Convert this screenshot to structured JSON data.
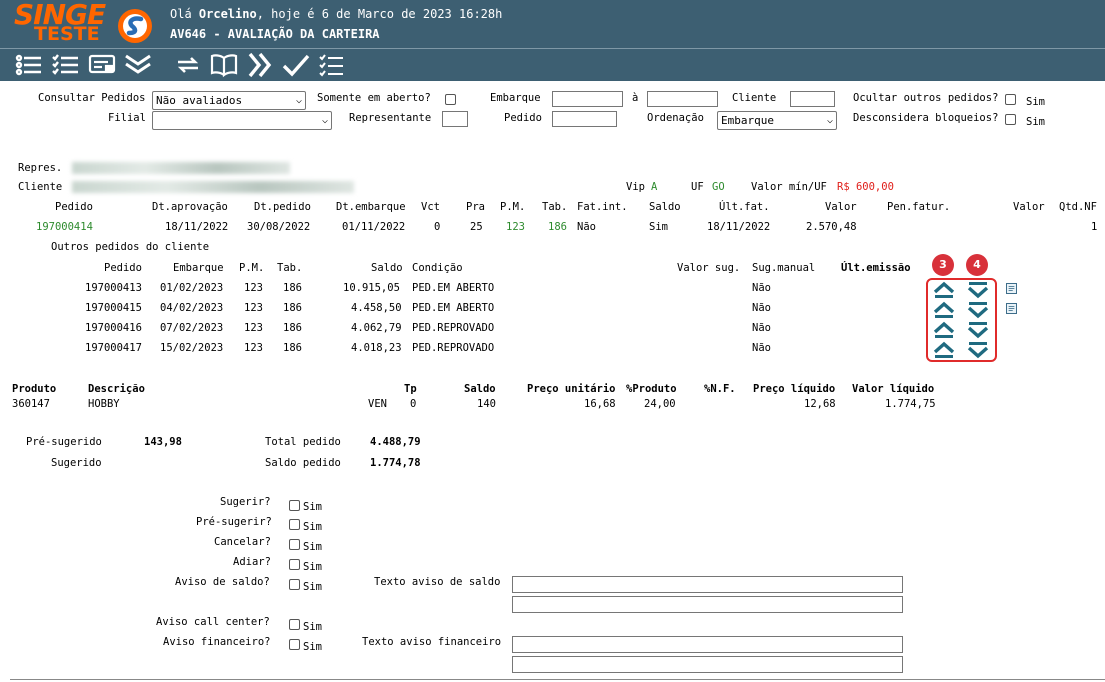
{
  "header": {
    "logo_line1": "SINGE",
    "logo_line2": "TESTE",
    "greeting_prefix": "Olá ",
    "user": "Orcelino",
    "greeting_suffix": ", hoje é 6 de Marco de 2023 16:28h",
    "screen_title": "AV646 - AVALIAÇÃO DA CARTEIRA"
  },
  "toolbar": [
    "list-icon",
    "checklist-icon",
    "card-icon",
    "double-chevron-down-icon",
    "refresh-icon",
    "book-icon",
    "double-chevron-right-icon",
    "checkmark-icon",
    "task-list-icon"
  ],
  "filters": {
    "consultar_label": "Consultar Pedidos",
    "consultar_value": "Não avaliados",
    "somente_label": "Somente em aberto?",
    "embarque_label": "Embarque",
    "a_label": "à",
    "cliente_label": "Cliente",
    "ocultar_label": "Ocultar outros pedidos?",
    "ocultar_sim": "Sim",
    "filial_label": "Filial",
    "filial_value": "",
    "representante_label": "Representante",
    "pedido_label": "Pedido",
    "ordenacao_label": "Ordenação",
    "ordenacao_value": "Embarque",
    "desconsidera_label": "Desconsidera bloqueios?",
    "desconsidera_sim": "Sim"
  },
  "client": {
    "repres_label": "Repres.",
    "cliente_label": "Cliente",
    "vip_label": "Vip",
    "vip_value": "A",
    "uf_label": "UF",
    "uf_value": "GO",
    "valor_min_label": "Valor mín/UF",
    "valor_min_value": "R$ 600,00"
  },
  "order_table": {
    "headers": [
      "Pedido",
      "Dt.aprovação",
      "Dt.pedido",
      "Dt.embarque",
      "Vct",
      "Pra",
      "P.M.",
      "Tab.",
      "Fat.int.",
      "Saldo",
      "Últ.fat.",
      "Valor",
      "Pen.fatur.",
      "Valor",
      "Qtd.NF"
    ],
    "row": [
      "197000414",
      "18/11/2022",
      "30/08/2022",
      "01/11/2022",
      "0",
      "25",
      "123",
      "186",
      "Não",
      "Sim",
      "18/11/2022",
      "2.570,48",
      "",
      "",
      "1"
    ]
  },
  "other_orders": {
    "title": "Outros pedidos do cliente",
    "headers": [
      "Pedido",
      "Embarque",
      "P.M.",
      "Tab.",
      "Saldo",
      "Condição",
      "Valor sug.",
      "Sug.manual",
      "Últ.emissão"
    ],
    "rows": [
      [
        "197000413",
        "01/02/2023",
        "123",
        "186",
        "10.915,05",
        "PED.EM ABERTO",
        "",
        "Não",
        ""
      ],
      [
        "197000415",
        "04/02/2023",
        "123",
        "186",
        "4.458,50",
        "PED.EM ABERTO",
        "",
        "Não",
        ""
      ],
      [
        "197000416",
        "07/02/2023",
        "123",
        "186",
        "4.062,79",
        "PED.REPROVADO",
        "",
        "Não",
        ""
      ],
      [
        "197000417",
        "15/02/2023",
        "123",
        "186",
        "4.018,23",
        "PED.REPROVADO",
        "",
        "Não",
        ""
      ]
    ],
    "callout_up": "3",
    "callout_down": "4"
  },
  "products": {
    "headers": [
      "Produto",
      "Descrição",
      "Tp",
      "Saldo",
      "Preço unitário",
      "%Produto",
      "%N.F.",
      "Preço líquido",
      "Valor líquido"
    ],
    "row": [
      "360147",
      "HOBBY",
      "VEN",
      "0",
      "140",
      "16,68",
      "24,00",
      "",
      "12,68",
      "1.774,75"
    ]
  },
  "totals": {
    "pre_sugerido_label": "Pré-sugerido",
    "pre_sugerido_value": "143,98",
    "sugerido_label": "Sugerido",
    "total_pedido_label": "Total pedido",
    "total_pedido_value": "4.488,79",
    "saldo_pedido_label": "Saldo pedido",
    "saldo_pedido_value": "1.774,78"
  },
  "questions": {
    "sugerir": "Sugerir?",
    "pre_sugerir": "Pré-sugerir?",
    "cancelar": "Cancelar?",
    "adiar": "Adiar?",
    "aviso_saldo": "Aviso de saldo?",
    "aviso_call": "Aviso call center?",
    "aviso_fin": "Aviso financeiro?",
    "sim": "Sim",
    "texto_aviso_saldo": "Texto aviso de saldo",
    "texto_aviso_fin": "Texto aviso financeiro"
  }
}
